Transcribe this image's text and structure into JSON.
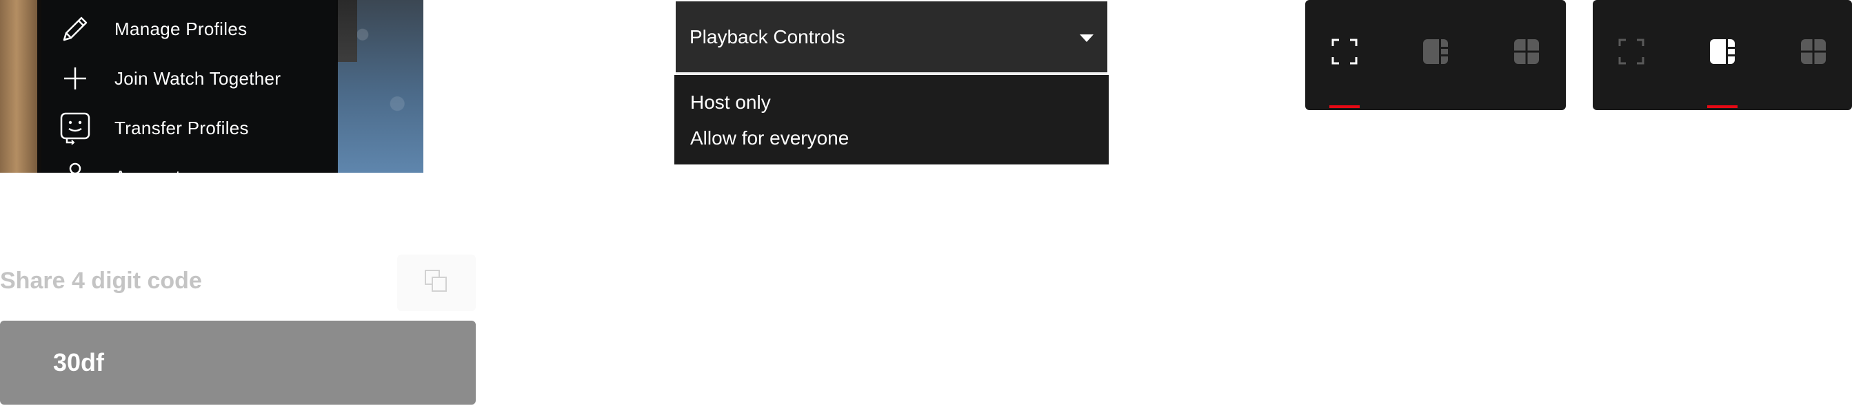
{
  "profile_menu": {
    "items": [
      {
        "label": "Manage Profiles",
        "icon": "pencil-icon"
      },
      {
        "label": "Join Watch Together",
        "icon": "plus-icon"
      },
      {
        "label": "Transfer Profiles",
        "icon": "transfer-profile-icon"
      },
      {
        "label": "Account",
        "icon": "account-icon"
      }
    ]
  },
  "share": {
    "label": "Share 4 digit code",
    "copy_icon": "copy-icon",
    "code": "30df"
  },
  "dropdown": {
    "selected": "Playback Controls",
    "options": [
      "Host only",
      "Allow for everyone"
    ]
  },
  "layout_switchers": [
    {
      "active": "fullscreen",
      "buttons": [
        "fullscreen-icon",
        "split-layout-icon",
        "grid-layout-icon"
      ]
    },
    {
      "active": "split",
      "buttons": [
        "fullscreen-icon",
        "split-layout-icon",
        "grid-layout-icon"
      ]
    }
  ],
  "colors": {
    "accent": "#e50914",
    "panel": "#1a1a1a",
    "dropdown_header": "#2b2b2b",
    "code_box": "#8c8c8c"
  }
}
